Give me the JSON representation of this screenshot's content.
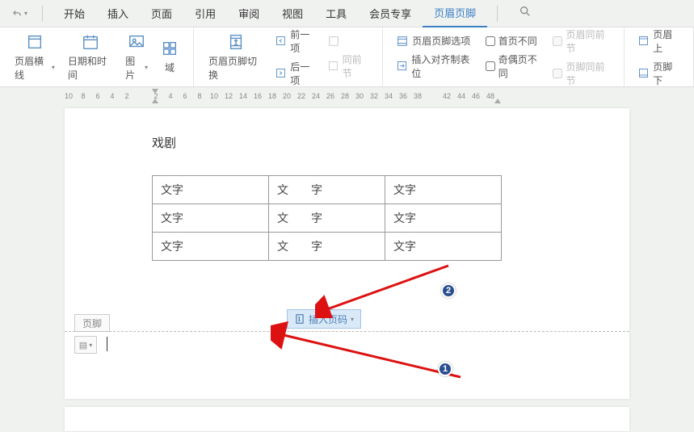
{
  "tabs": {
    "start": "开始",
    "insert": "插入",
    "page": "页面",
    "reference": "引用",
    "review": "审阅",
    "view": "视图",
    "tools": "工具",
    "vip": "会员专享",
    "header_footer": "页眉页脚"
  },
  "ribbon": {
    "header_line": "页眉横线",
    "date_time": "日期和时间",
    "picture": "图片",
    "field": "域",
    "hf_switch": "页眉页脚切换",
    "prev": "前一项",
    "next": "后一项",
    "same_prev": "同前节",
    "hf_options": "页眉页脚选项",
    "insert_tab": "插入对齐制表位",
    "first_diff": "首页不同",
    "odd_even_diff": "奇偶页不同",
    "header_same": "页眉同前节",
    "footer_same": "页脚同前节",
    "header_top": "页眉上",
    "footer_bottom": "页脚下"
  },
  "ruler": [
    "10",
    "8",
    "6",
    "4",
    "2",
    "",
    "2",
    "4",
    "6",
    "8",
    "10",
    "12",
    "14",
    "16",
    "18",
    "20",
    "22",
    "24",
    "26",
    "28",
    "30",
    "32",
    "34",
    "36",
    "38",
    "",
    "42",
    "44",
    "46",
    "48"
  ],
  "doc": {
    "title": "戏剧",
    "cells": [
      [
        "文字",
        "文　　字",
        "文字"
      ],
      [
        "文字",
        "文　　字",
        "文字"
      ],
      [
        "文字",
        "文　　字",
        "文字"
      ]
    ],
    "footer_label": "页脚",
    "insert_page_number": "插入页码"
  },
  "badges": {
    "one": "1",
    "two": "2"
  }
}
